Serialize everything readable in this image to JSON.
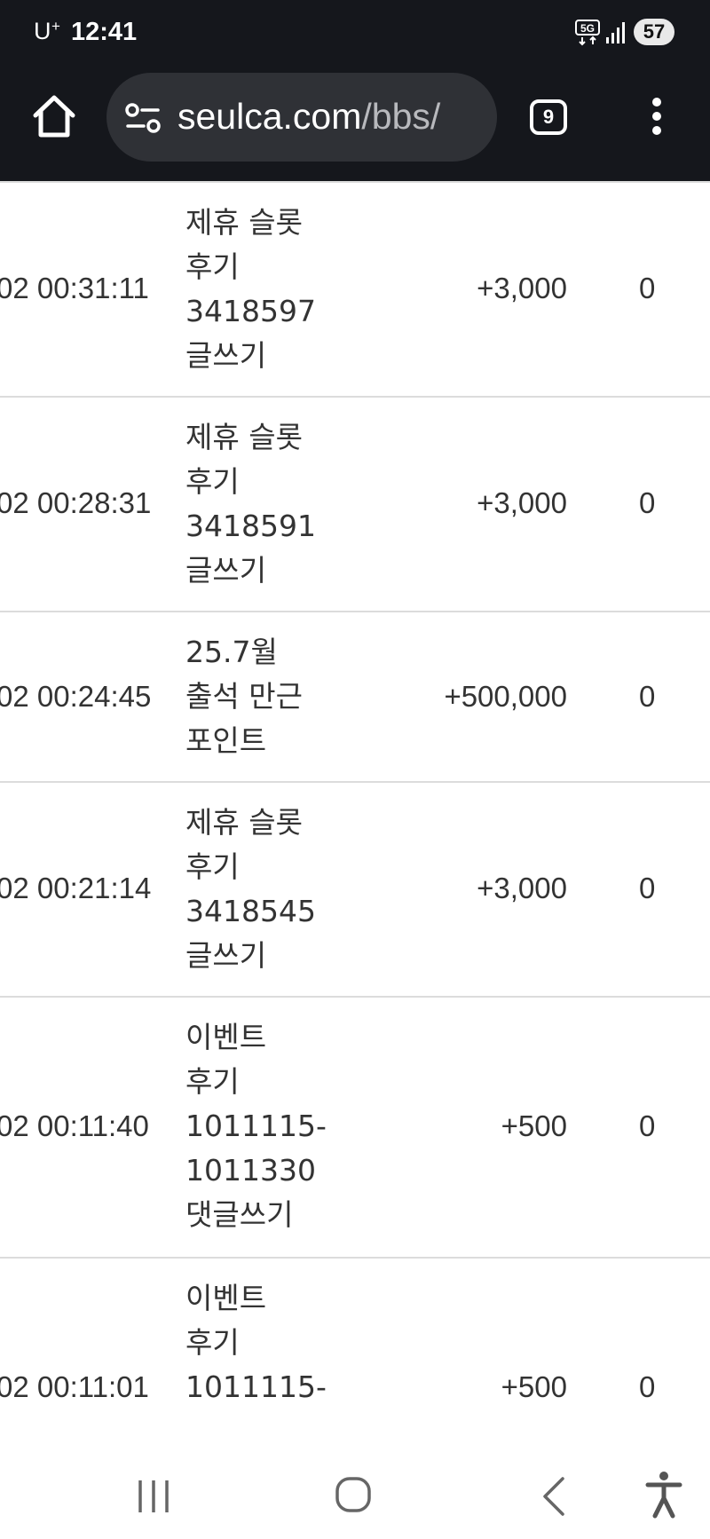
{
  "status": {
    "carrier": "U",
    "carrier_sup": "+",
    "time": "12:41",
    "network": "5G",
    "battery": "57"
  },
  "browser": {
    "url_domain": "seulca.com",
    "url_path": "/bbs/",
    "tab_count": "9"
  },
  "table": {
    "rows": [
      {
        "date": "02 00:31:11",
        "desc": "제휴 슬롯 후기 3418597 글쓰기",
        "amount": "+3,000",
        "use": "0"
      },
      {
        "date": "02 00:28:31",
        "desc": "제휴 슬롯 후기 3418591 글쓰기",
        "amount": "+3,000",
        "use": "0"
      },
      {
        "date": "02 00:24:45",
        "desc": "25.7월 출석 만근 포인트",
        "amount": "+500,000",
        "use": "0"
      },
      {
        "date": "02 00:21:14",
        "desc": "제휴 슬롯 후기 3418545 글쓰기",
        "amount": "+3,000",
        "use": "0"
      },
      {
        "date": "02 00:11:40",
        "desc": "이벤트 후기 1011115-1011330 댓글쓰기",
        "amount": "+500",
        "use": "0"
      },
      {
        "date": "02 00:11:01",
        "desc": "이벤트 후기 1011115-",
        "amount": "+500",
        "use": "0"
      }
    ]
  },
  "icons": {
    "home": "home-icon",
    "site_settings": "site-settings-icon",
    "menu": "more-vert-icon",
    "recents": "recents-icon",
    "home_nav": "home-nav-icon",
    "back": "back-icon",
    "accessibility": "accessibility-icon"
  },
  "colors": {
    "toolbar_bg": "#15171c",
    "url_pill_bg": "#2f3136",
    "divider": "#dcdcdc"
  }
}
